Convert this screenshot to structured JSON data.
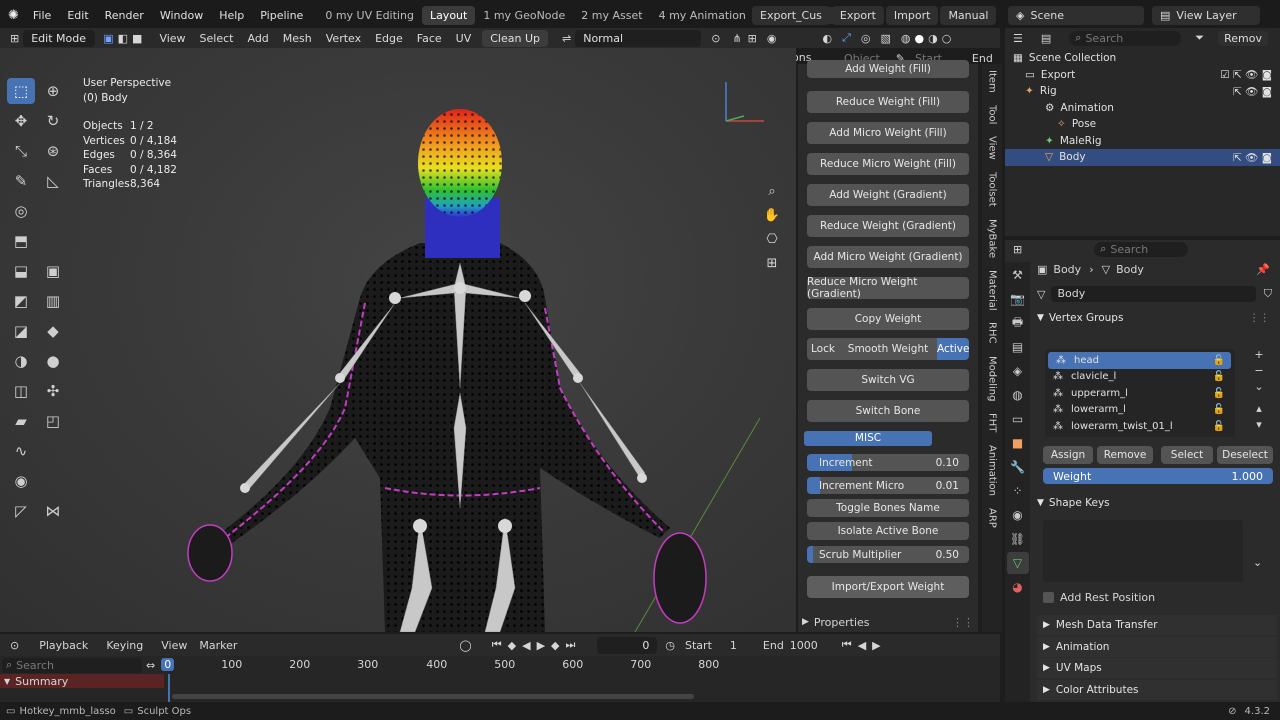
{
  "topbar": {
    "menus": [
      "File",
      "Edit",
      "Render",
      "Window",
      "Help",
      "Pipeline"
    ],
    "workspaces": [
      {
        "label": "0 my UV Editing",
        "active": false
      },
      {
        "label": "Layout",
        "active": true
      },
      {
        "label": "1 my GeoNode",
        "active": false
      },
      {
        "label": "2 my Asset",
        "active": false
      },
      {
        "label": "4 my Animation",
        "active": false
      }
    ],
    "add_tab": "+",
    "error_count": "0",
    "warning_count": "0",
    "addons": [
      "Export_Cus",
      "Export",
      "Import",
      "Manual"
    ],
    "scene_label": "Scene",
    "view_layer_label": "View Layer"
  },
  "vpheader": {
    "mode": "Edit Mode",
    "menus": [
      "View",
      "Select",
      "Add",
      "Mesh",
      "Vertex",
      "Edge",
      "Face",
      "UV"
    ],
    "clean_up": "Clean Up",
    "orientation": "Normal",
    "dr_labels": [
      "D",
      "R"
    ],
    "axes": [
      "X",
      "Y",
      "Z"
    ],
    "options": "Options",
    "object_label": "Object",
    "start": "Start",
    "end": "End"
  },
  "viewport": {
    "title": "User Perspective",
    "object": "(0) Body",
    "stats": [
      {
        "label": "Objects",
        "value": "1 / 2"
      },
      {
        "label": "Vertices",
        "value": "0 / 4,184"
      },
      {
        "label": "Edges",
        "value": "0 / 8,364"
      },
      {
        "label": "Faces",
        "value": "0 / 4,182"
      },
      {
        "label": "Triangles",
        "value": "8,364"
      }
    ]
  },
  "npanel": {
    "partial_top": "Add Weight (Fill)",
    "buttons": [
      "Reduce Weight (Fill)",
      "Add Micro Weight (Fill)",
      "Reduce Micro Weight (Fill)",
      "Add Weight (Gradient)",
      "Reduce Weight (Gradient)",
      "Add Micro Weight (Gradient)",
      "Reduce Micro Weight (Gradient)",
      "Copy Weight"
    ],
    "lock": "Lock",
    "smooth": "Smooth Weight",
    "active": "Active",
    "switch_vg": "Switch VG",
    "switch_bone": "Switch Bone",
    "misc": "MISC",
    "sliders": [
      {
        "label": "Increment",
        "value": "0.10",
        "fill": 0.28
      },
      {
        "label": "Increment Micro",
        "value": "0.01",
        "fill": 0.08
      }
    ],
    "toggle_bones": "Toggle Bones Name",
    "isolate": "Isolate Active Bone",
    "scrub": {
      "label": "Scrub Multiplier",
      "value": "0.50",
      "fill": 0.04
    },
    "import_export": "Import/Export Weight",
    "properties": "Properties",
    "tabs": [
      "Item",
      "Tool",
      "View",
      "Toolset",
      "MyBake",
      "Material",
      "RHC",
      "Modeling",
      "FHT",
      "Animation",
      "ARP"
    ]
  },
  "outliner": {
    "search_placeholder": "Search",
    "remove": "Remov",
    "rows": [
      "Scene Collection",
      "Export",
      "Rig",
      "Animation",
      "Pose",
      "MaleRig",
      "Body"
    ]
  },
  "props": {
    "search_placeholder": "Search",
    "breadcrumb": [
      "Body",
      "Body"
    ],
    "data_name": "Body",
    "vertex_groups": "Vertex Groups",
    "groups": [
      "head",
      "clavicle_l",
      "upperarm_l",
      "lowerarm_l",
      "lowerarm_twist_01_l"
    ],
    "assign": "Assign",
    "remove": "Remove",
    "select": "Select",
    "deselect": "Deselect",
    "weight_label": "Weight",
    "weight_value": "1.000",
    "shape_keys": "Shape Keys",
    "add_rest": "Add Rest Position",
    "sections": [
      "Mesh Data Transfer",
      "Animation",
      "UV Maps",
      "Color Attributes"
    ]
  },
  "timeline": {
    "menus": [
      "Playback",
      "Keying",
      "View",
      "Marker"
    ],
    "current_frame": "0",
    "start_label": "Start",
    "start_value": "1",
    "end_label": "End",
    "end_value": "1000",
    "search_placeholder": "Search",
    "ticks": [
      "0",
      "100",
      "200",
      "300",
      "400",
      "500",
      "600",
      "700",
      "800"
    ],
    "summary": "Summary"
  },
  "statusbar": {
    "left1": "Hotkey_mmb_lasso",
    "left2": "Sculpt Ops",
    "version": "4.3.2"
  },
  "colors": {
    "accent": "#4772b3",
    "selection": "#334d80",
    "seam": "#c43cc4"
  }
}
